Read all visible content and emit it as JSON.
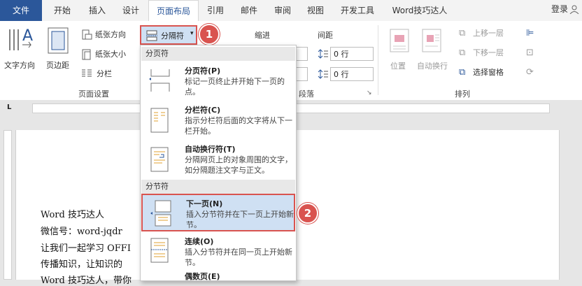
{
  "tabs": [
    {
      "label": "文件",
      "active": false,
      "file": true
    },
    {
      "label": "开始"
    },
    {
      "label": "插入"
    },
    {
      "label": "设计"
    },
    {
      "label": "页面布局",
      "active": true
    },
    {
      "label": "引用"
    },
    {
      "label": "邮件"
    },
    {
      "label": "审阅"
    },
    {
      "label": "视图"
    },
    {
      "label": "开发工具"
    },
    {
      "label": "Word技巧达人"
    }
  ],
  "login": "登录",
  "ribbon": {
    "text_direction": "文字方向",
    "margins": "页边距",
    "orientation": "纸张方向",
    "size": "纸张大小",
    "columns": "分栏",
    "breaks": "分隔符",
    "page_setup_label": "页面设置",
    "indent_label": "缩进",
    "spacing_label": "间距",
    "spacing_before": "0 行",
    "spacing_after": "0 行",
    "paragraph_label": "段落",
    "position": "位置",
    "wrap_text": "自动换行",
    "bring_forward": "上移一层",
    "send_backward": "下移一层",
    "selection_pane": "选择窗格",
    "arrange_label": "排列"
  },
  "document": {
    "lines": [
      "Word 技巧达人",
      "微信号：word-jqdr",
      "让我们一起学习 OFFI",
      "传播知识，让知识的",
      "Word 技巧达人，带你"
    ]
  },
  "dropdown": {
    "page_breaks_header": "分页符",
    "section_breaks_header": "分节符",
    "items": [
      {
        "title": "分页符(P)",
        "desc": "标记一页终止并开始下一页的点。"
      },
      {
        "title": "分栏符(C)",
        "desc": "指示分栏符后面的文字将从下一栏开始。"
      },
      {
        "title": "自动换行符(T)",
        "desc": "分隔网页上的对象周围的文字，如分隔题注文字与正文。"
      },
      {
        "title": "下一页(N)",
        "desc": "插入分节符并在下一页上开始新节。"
      },
      {
        "title": "连续(O)",
        "desc": "插入分节符并在同一页上开始新节。"
      },
      {
        "title": "偶数页(E)",
        "desc": ""
      }
    ]
  },
  "callouts": [
    "1",
    "2"
  ],
  "colors": {
    "accent": "#2b579a",
    "highlight": "#cfe0f3",
    "callout": "#d9534f"
  }
}
